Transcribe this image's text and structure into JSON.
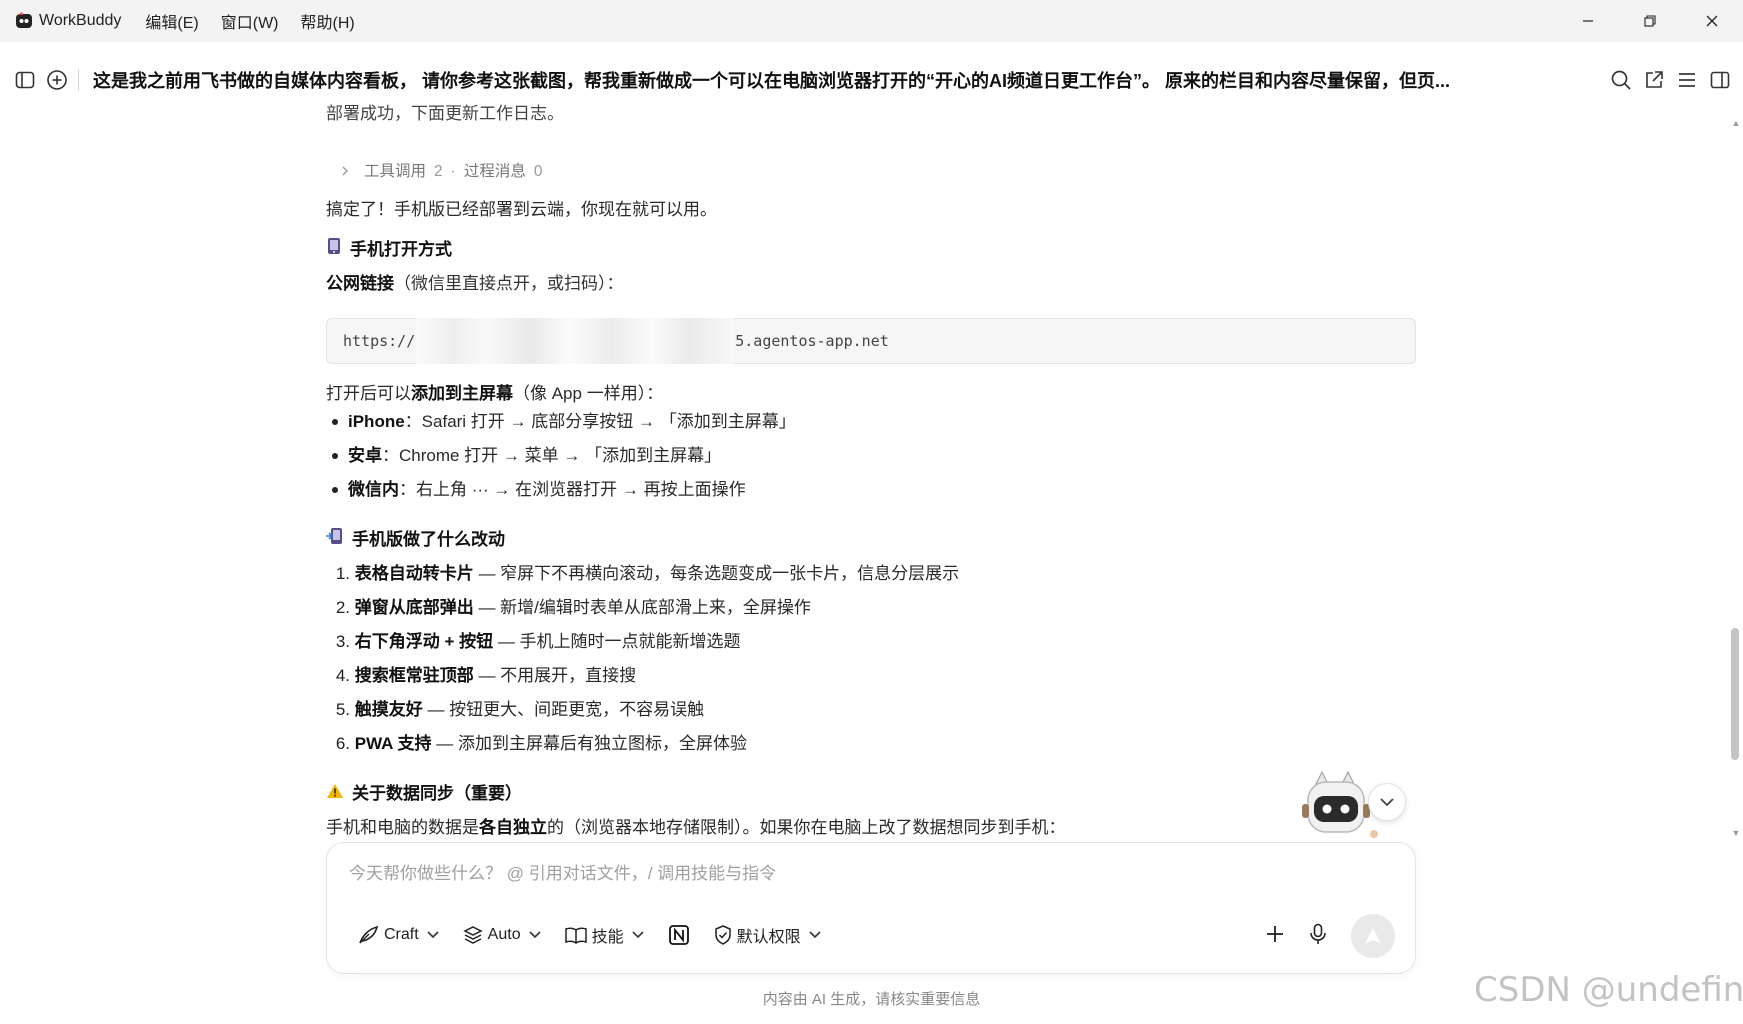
{
  "app": {
    "name": "WorkBuddy",
    "menus": [
      "编辑(E)",
      "窗口(W)",
      "帮助(H)"
    ]
  },
  "header": {
    "title": "这是我之前用飞书做的自媒体内容看板， 请你参考这张截图，帮我重新做成一个可以在电脑浏览器打开的“开心的AI频道日更工作台”。 原来的栏目和内容尽量保留，但页..."
  },
  "message": {
    "cut_line": "部署成功，下面更新工作日志。",
    "tool_calls_label": "工具调用",
    "tool_calls_count": "2",
    "process_label": "过程消息",
    "process_count": "0",
    "intro": "搞定了！手机版已经部署到云端，你现在就可以用。",
    "open_section": {
      "heading": "手机打开方式",
      "link_label_bold": "公网链接",
      "link_label_rest": "（微信里直接点开，或扫码）：",
      "url_prefix": "https://",
      "url_suffix": "5.agentos-app.net",
      "add_home_pre": "打开后可以",
      "add_home_bold": "添加到主屏幕",
      "add_home_post": "（像 App 一样用）：",
      "bullets": [
        {
          "bold": "iPhone",
          "text": "：Safari 打开 → 底部分享按钮 → 「添加到主屏幕」"
        },
        {
          "bold": "安卓",
          "text": "：Chrome 打开 → 菜单 → 「添加到主屏幕」"
        },
        {
          "bold": "微信内",
          "text": "：右上角 ··· → 在浏览器打开 → 再按上面操作"
        }
      ]
    },
    "changes_section": {
      "heading": "手机版做了什么改动",
      "items": [
        {
          "num": "1.",
          "bold": "表格自动转卡片",
          "text": " — 窄屏下不再横向滚动，每条选题变成一张卡片，信息分层展示"
        },
        {
          "num": "2.",
          "bold": "弹窗从底部弹出",
          "text": " — 新增/编辑时表单从底部滑上来，全屏操作"
        },
        {
          "num": "3.",
          "bold": "右下角浮动 + 按钮",
          "text": " — 手机上随时一点就能新增选题"
        },
        {
          "num": "4.",
          "bold": "搜索框常驻顶部",
          "text": " — 不用展开，直接搜"
        },
        {
          "num": "5.",
          "bold": "触摸友好",
          "text": " — 按钮更大、间距更宽，不容易误触"
        },
        {
          "num": "6.",
          "bold": "PWA 支持",
          "text": " — 添加到主屏幕后有独立图标，全屏体验"
        }
      ]
    },
    "sync_section": {
      "heading": "关于数据同步（重要）",
      "text_pre": "手机和电脑的数据是",
      "text_bold": "各自独立",
      "text_post": "的（浏览器本地存储限制）。如果你在电脑上改了数据想同步到手机："
    }
  },
  "composer": {
    "placeholder": "今天帮你做些什么？ @ 引用对话文件，/ 调用技能与指令",
    "mode_label": "Craft",
    "model_label": "Auto",
    "skills_label": "技能",
    "permission_label": "默认权限"
  },
  "footer": {
    "disclaimer": "内容由 AI 生成，请核实重要信息"
  },
  "watermark": "CSDN @undefined"
}
